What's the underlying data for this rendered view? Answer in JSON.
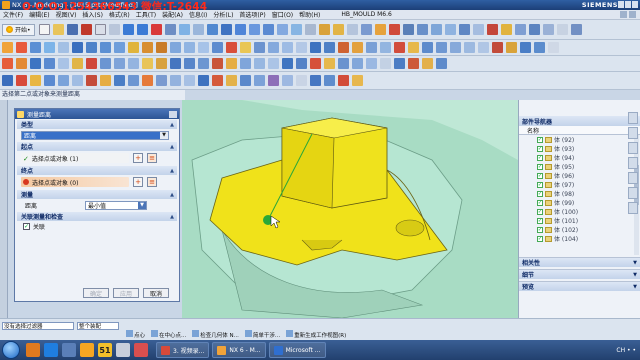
{
  "titlebar": {
    "title": "NX 6 - Modeling - [3015.prt (Modified)]",
    "watermark": "Q·Q·Q:1254366543 微信:T-2644",
    "brand": "SIEMENS"
  },
  "menubar": {
    "items": [
      "文件(F)",
      "编辑(E)",
      "视图(V)",
      "插入(S)",
      "格式(R)",
      "工具(T)",
      "装配(A)",
      "信息(I)",
      "分析(L)",
      "首选项(P)",
      "窗口(O)",
      "帮助(H)"
    ],
    "filename": "HB_MOULD M6.6"
  },
  "toolbar": {
    "start_label": "开始•"
  },
  "dialog_strip": {
    "text": "选择第二点或对象来测量距离"
  },
  "dialog": {
    "title": "测量距离",
    "type_section": "类型",
    "type_value": "距离",
    "start_section": "起点",
    "start_field": "选择点或对象 (1)",
    "end_section": "终点",
    "end_field": "选择点或对象 (0)",
    "measure_section": "测量",
    "distance_label": "距离",
    "distance_value": "最小值",
    "assoc_section": "关联测量和检查",
    "assoc_check": "关联",
    "buttons": {
      "ok": "确定",
      "apply": "应用",
      "cancel": "取消"
    }
  },
  "navigator": {
    "title": "部件导航器",
    "column_name": "名称",
    "rows": [
      "体 (92)",
      "体 (93)",
      "体 (94)",
      "体 (95)",
      "体 (96)",
      "体 (97)",
      "体 (98)",
      "体 (99)",
      "体 (100)",
      "体 (101)",
      "体 (102)",
      "体 (104)"
    ],
    "dependents": "相关性",
    "details": "细节",
    "preview": "预览"
  },
  "statusbar": {
    "filter_type": "没有选择过滤器",
    "filter_assembly": "整个装配",
    "items": [
      "点心",
      "在中心点...",
      "检查几何体 N...",
      "简单干涉...",
      "重新生成工作视图(R)"
    ]
  },
  "taskbar": {
    "quick_51": "51",
    "tasks": [
      "3. 视频录...",
      "NX 6 - M...",
      "Microsoft ..."
    ],
    "tray": "CH • •"
  },
  "colors": {
    "yellow_part": "#f0e21a",
    "mold_green": "#a8dcc4",
    "core_green": "#b6e6d2",
    "measure_line": "#2aa838"
  }
}
